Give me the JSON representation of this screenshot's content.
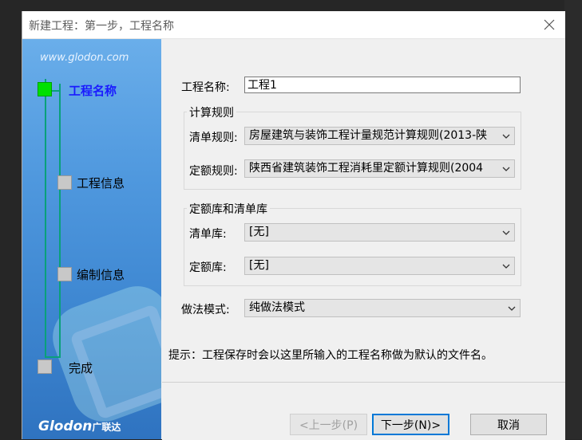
{
  "window": {
    "title": "新建工程：第一步，工程名称"
  },
  "sidebar": {
    "site_url": "www.glodon.com",
    "steps": [
      {
        "label": "工程名称",
        "active": true
      },
      {
        "label": "工程信息",
        "active": false
      },
      {
        "label": "编制信息",
        "active": false
      },
      {
        "label": "完成",
        "active": false
      }
    ],
    "brand": "Glodon",
    "brand_cn": "广联达"
  },
  "form": {
    "project_name_label": "工程名称:",
    "project_name_value": "工程1",
    "calc_rules": {
      "group_title": "计算规则",
      "list_rule_label": "清单规则:",
      "list_rule_value": "房屋建筑与装饰工程计量规范计算规则(2013-陕",
      "quota_rule_label": "定额规则:",
      "quota_rule_value": "陕西省建筑装饰工程消耗里定额计算规则(2004"
    },
    "libraries": {
      "group_title": "定额库和清单库",
      "list_lib_label": "清单库:",
      "list_lib_value": "[无]",
      "quota_lib_label": "定额库:",
      "quota_lib_value": "[无]"
    },
    "method_label": "做法模式:",
    "method_value": "纯做法模式",
    "hint": "提示：工程保存时会以这里所输入的工程名称做为默认的文件名。"
  },
  "buttons": {
    "prev": "<上一步(P)",
    "next": "下一步(N)>",
    "cancel": "取消"
  }
}
